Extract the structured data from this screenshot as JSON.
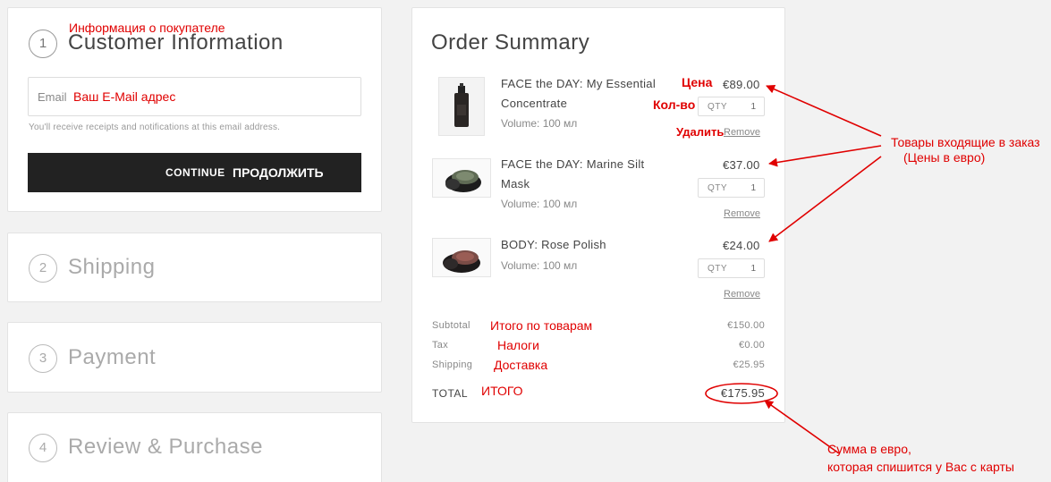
{
  "customer": {
    "step_number": "1",
    "title": "Customer Information",
    "annotation_title": "Информация о покупателе",
    "email_placeholder": "Email",
    "annotation_email": "Ваш E-Mail адрес",
    "email_note": "You'll receive receipts and notifications at this email address.",
    "continue_label": "CONTINUE",
    "annotation_continue": "ПРОДОЛЖИТЬ"
  },
  "steps": [
    {
      "number": "2",
      "title": "Shipping"
    },
    {
      "number": "3",
      "title": "Payment"
    },
    {
      "number": "4",
      "title": "Review & Purchase"
    }
  ],
  "summary": {
    "title": "Order Summary",
    "qty_label": "QTY",
    "remove_label": "Remove",
    "items": [
      {
        "name_line1": "FACE the DAY: My Essential",
        "name_line2": "Concentrate",
        "volume": "Volume: 100 мл",
        "price": "€89.00",
        "qty": "1"
      },
      {
        "name_line1": "FACE the DAY: Marine Silt",
        "name_line2": "Mask",
        "volume": "Volume: 100 мл",
        "price": "€37.00",
        "qty": "1"
      },
      {
        "name_line1": "BODY: Rose Polish",
        "name_line2": "",
        "volume": "Volume: 100 мл",
        "price": "€24.00",
        "qty": "1"
      }
    ],
    "subtotal_label": "Subtotal",
    "subtotal_value": "€150.00",
    "tax_label": "Tax",
    "tax_value": "€0.00",
    "shipping_label": "Shipping",
    "shipping_value": "€25.95",
    "total_label": "TOTAL",
    "total_value": "€175.95"
  },
  "annotations": {
    "price": "Цена",
    "qty": "Кол-во",
    "remove": "Удалить",
    "items_line1": "Товары входящие в заказ",
    "items_line2": "(Цены в евро)",
    "subtotal": "Итого по товарам",
    "tax": "Налоги",
    "shipping": "Доставка",
    "total": "ИТОГО",
    "charge_line1": "Сумма в евро,",
    "charge_line2": "которая спишится у Вас с карты"
  },
  "colors": {
    "annotation": "#e00000",
    "button": "#222222",
    "background": "#f2f2f2"
  }
}
